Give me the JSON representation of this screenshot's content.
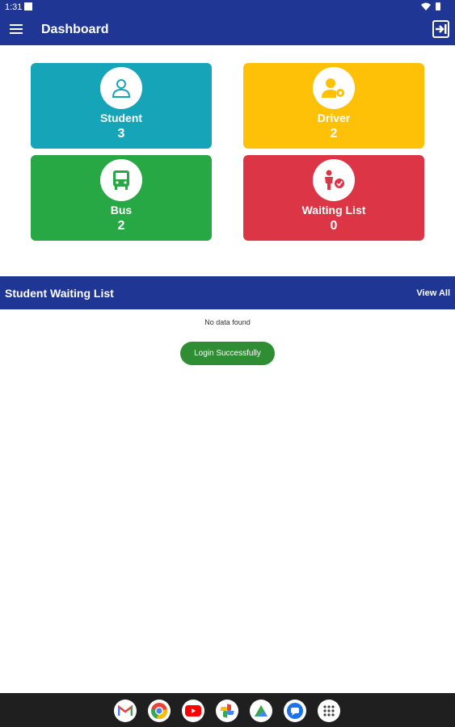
{
  "status_bar": {
    "time": "1:31"
  },
  "toolbar": {
    "title": "Dashboard",
    "menu_icon": "hamburger-menu-icon",
    "logout_icon": "logout-icon"
  },
  "colors": {
    "primary": "#1f3695",
    "student": "#16a5b8",
    "driver": "#ffc107",
    "bus": "#28a745",
    "waiting": "#dc3545",
    "toast": "#2f8e33"
  },
  "cards": [
    {
      "label": "Student",
      "count": "3",
      "icon": "person-icon"
    },
    {
      "label": "Driver",
      "count": "2",
      "icon": "user-gear-icon"
    },
    {
      "label": "Bus",
      "count": "2",
      "icon": "bus-icon"
    },
    {
      "label": "Waiting List",
      "count": "0",
      "icon": "person-check-icon"
    }
  ],
  "waiting_list": {
    "title": "Student Waiting List",
    "view_all": "View All",
    "empty_text": "No data found"
  },
  "toast": {
    "text": "Login Successfully"
  },
  "dock": [
    "gmail-icon",
    "chrome-icon",
    "youtube-icon",
    "photos-icon",
    "files-icon",
    "messages-icon",
    "app-drawer-icon"
  ]
}
